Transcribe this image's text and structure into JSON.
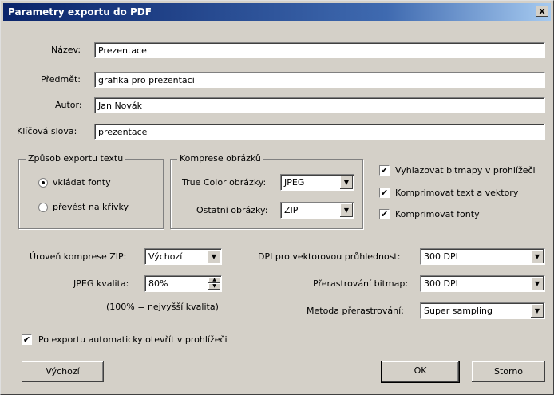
{
  "window": {
    "title": "Parametry exportu do PDF",
    "close_glyph": "x"
  },
  "fields": {
    "nazev": {
      "label": "Název:",
      "value": "Prezentace"
    },
    "predmet": {
      "label": "Předmět:",
      "value": "grafika pro prezentaci"
    },
    "autor": {
      "label": "Autor:",
      "value": "Jan Novák"
    },
    "klicova_slova": {
      "label": "Klíčová slova:",
      "value": "prezentace"
    }
  },
  "text_export": {
    "title": "Způsob exportu textu",
    "options": [
      {
        "label": "vkládat fonty",
        "selected": true
      },
      {
        "label": "převést na křivky",
        "selected": false
      }
    ]
  },
  "compression": {
    "title": "Komprese obrázků",
    "true_color": {
      "label": "True Color obrázky:",
      "value": "JPEG"
    },
    "other": {
      "label": "Ostatní obrázky:",
      "value": "ZIP"
    }
  },
  "checkboxes": [
    {
      "label": "Vyhlazovat bitmapy v prohlížeči",
      "checked": true
    },
    {
      "label": "Komprimovat text a vektory",
      "checked": true
    },
    {
      "label": "Komprimovat fonty",
      "checked": true
    }
  ],
  "zip_level": {
    "label": "Úroveň komprese ZIP:",
    "value": "Výchozí"
  },
  "jpeg_quality": {
    "label": "JPEG kvalita:",
    "value": "80%",
    "note": "(100% = nejvyšší kvalita)"
  },
  "dpi_vector": {
    "label": "DPI pro vektorovou průhlednost:",
    "value": "300 DPI"
  },
  "rasterize": {
    "label": "Přerastrování bitmap:",
    "value": "300 DPI"
  },
  "raster_method": {
    "label": "Metoda přerastrování:",
    "value": "Super sampling"
  },
  "auto_open": {
    "label": "Po exportu automaticky otevřít v prohlížeči",
    "checked": true
  },
  "buttons": {
    "default": "Výchozí",
    "ok": "OK",
    "cancel": "Storno"
  },
  "check_glyph": "✔",
  "arrow_glyph": "▼",
  "spin_up_glyph": "▲",
  "spin_down_glyph": "▼"
}
